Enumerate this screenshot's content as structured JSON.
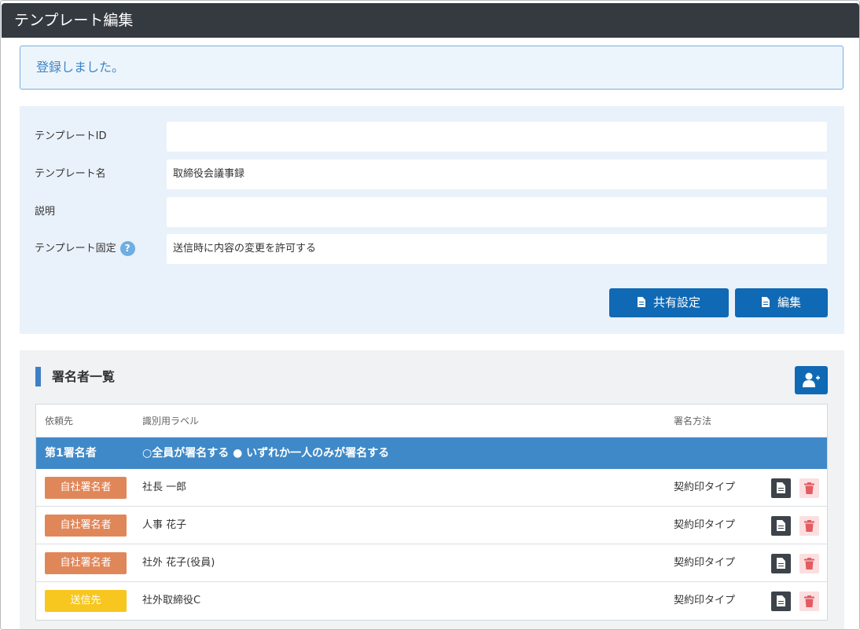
{
  "window": {
    "title": "テンプレート編集"
  },
  "alert": {
    "message": "登録しました。"
  },
  "form": {
    "fields": [
      {
        "label": "テンプレートID",
        "value": ""
      },
      {
        "label": "テンプレート名",
        "value": "取締役会議事録"
      },
      {
        "label": "説明",
        "value": ""
      },
      {
        "label": "テンプレート固定",
        "value": "送信時に内容の変更を許可する",
        "help": "?"
      }
    ],
    "buttons": {
      "share": "共有設定",
      "edit": "編集"
    }
  },
  "signers": {
    "title": "署名者一覧",
    "columns": {
      "requestee": "依頼先",
      "label": "識別用ラベル",
      "method": "署名方法"
    },
    "group": {
      "name": "第1署名者",
      "mode_text": "○全員が署名する ● いずれか一人のみが署名する"
    },
    "rows": [
      {
        "badge": "自社署名者",
        "badge_color": "#e0875a",
        "label": "社長 一郎",
        "method": "契約印タイプ"
      },
      {
        "badge": "自社署名者",
        "badge_color": "#e0875a",
        "label": "人事 花子",
        "method": "契約印タイプ"
      },
      {
        "badge": "自社署名者",
        "badge_color": "#e0875a",
        "label": "社外 花子(役員)",
        "method": "契約印タイプ"
      },
      {
        "badge": "送信先",
        "badge_color": "#f7c71f",
        "label": "社外取締役C",
        "method": "契約印タイプ"
      }
    ]
  },
  "colors": {
    "titlebar": "#343a40",
    "primary": "#0f69b4",
    "group_row": "#3f89c8",
    "alert_text": "#3c84c6",
    "delete_bg": "#fbdfe0",
    "delete_icon": "#e25c62"
  },
  "icons": {
    "help": "question-circle-icon",
    "share": "document-icon",
    "edit": "document-icon",
    "add_user": "user-plus-icon",
    "row_doc": "document-icon",
    "row_delete": "trash-icon"
  }
}
